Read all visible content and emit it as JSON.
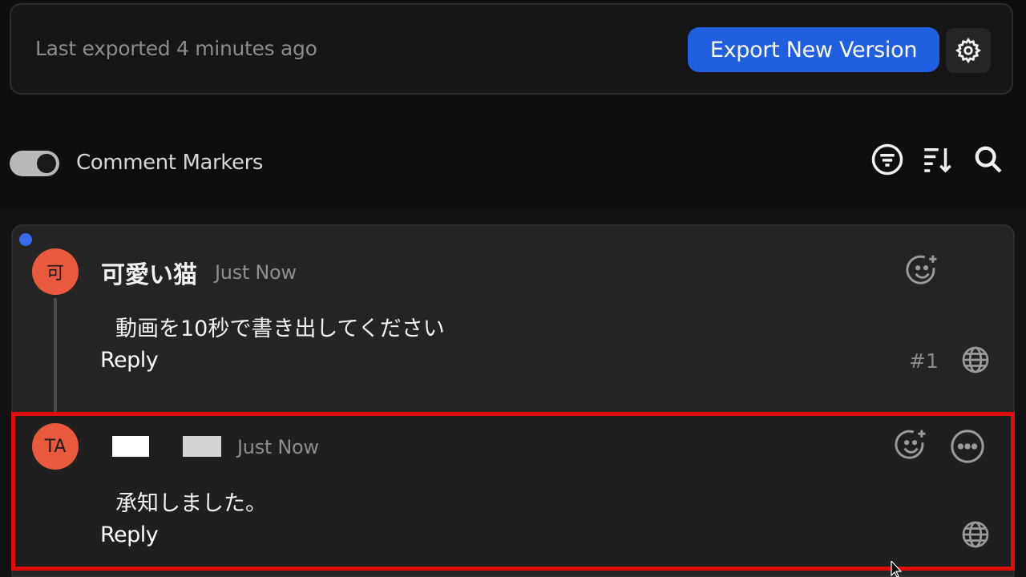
{
  "export_panel": {
    "last_exported": "Last exported 4 minutes ago",
    "export_button": "Export New Version",
    "settings_icon": "gear-icon",
    "accent_color": "#1f5fe0"
  },
  "toolbar": {
    "markers_label": "Comment Markers",
    "markers_enabled": true,
    "icons": [
      "filter-icon",
      "sort-icon",
      "search-icon"
    ]
  },
  "comments": [
    {
      "avatar": "可",
      "author": "可愛い猫",
      "time": "Just Now",
      "text": "動画を10秒で書き出してください",
      "reply_label": "Reply",
      "number": "#1",
      "unread": true
    },
    {
      "avatar": "TA",
      "author": "",
      "time": "Just Now",
      "text": "承知しました。",
      "reply_label": "Reply",
      "highlighted": true
    }
  ],
  "colors": {
    "highlight": "#e10c0c",
    "avatar": "#e8593e",
    "unread_dot": "#3b6af0"
  }
}
